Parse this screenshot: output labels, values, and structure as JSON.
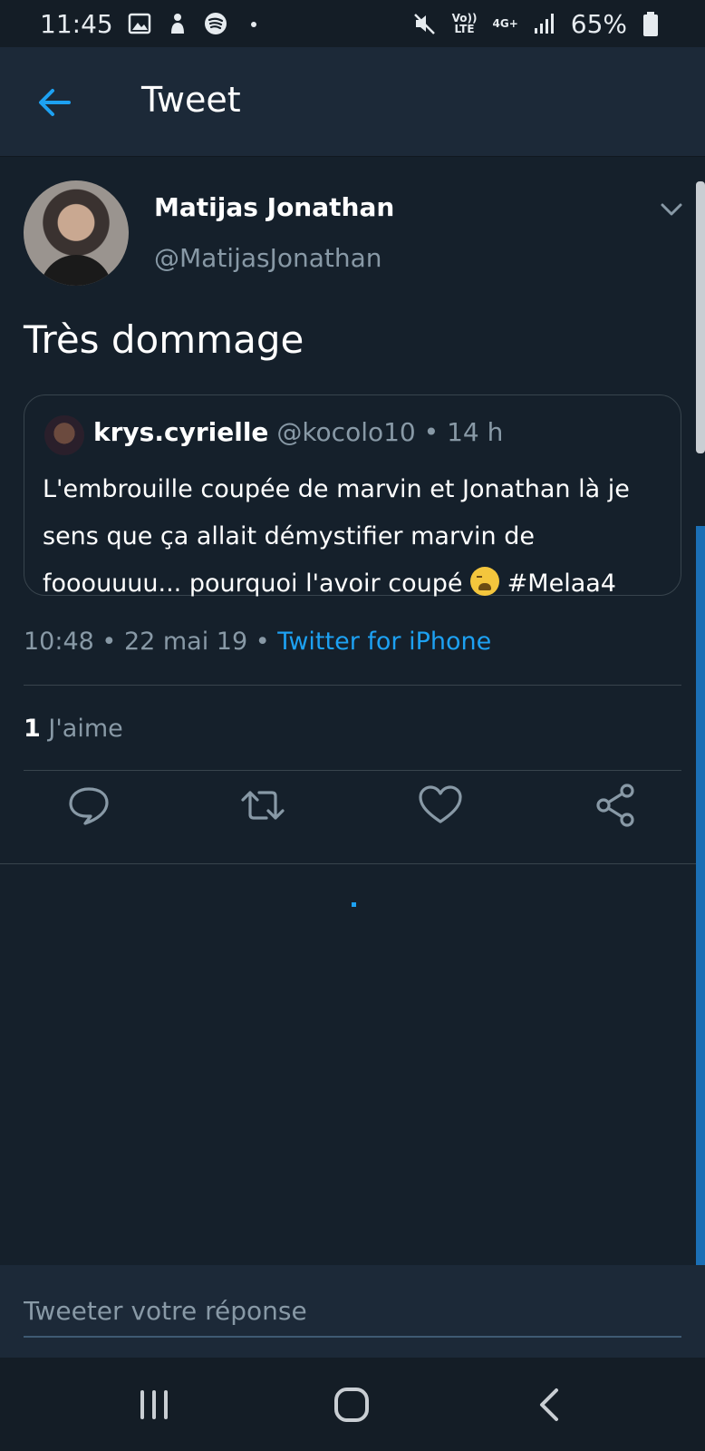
{
  "status_bar": {
    "time": "11:45",
    "volte_label": "Vo)) LTE",
    "network_label": "4G+",
    "battery": "65%"
  },
  "app_bar": {
    "title": "Tweet"
  },
  "tweet": {
    "author_name": "Matijas Jonathan",
    "author_handle": "@MatijasJonathan",
    "text": "Très dommage",
    "quoted": {
      "name": "krys.cyrielle",
      "handle": "@kocolo10",
      "separator": "•",
      "age": "14 h",
      "body": "L'embrouille coupée de marvin et Jonathan là je sens que ça allait démystifier marvin de fooouuuu... pourquoi l'avoir coupé",
      "hashtag": "#Melaa4"
    },
    "time": "10:48",
    "separator": "•",
    "date": "22 mai 19",
    "source": "Twitter for iPhone",
    "likes_count": "1",
    "likes_label": "J'aime"
  },
  "reply": {
    "placeholder": "Tweeter votre réponse"
  },
  "colors": {
    "background": "#15202b",
    "appbar": "#1c2938",
    "accent": "#1da1f2",
    "secondary_text": "#8899a6",
    "border": "#38444d"
  },
  "icons": {
    "back": "arrow-left-icon",
    "menu": "chevron-down-icon",
    "reply": "comment-icon",
    "retweet": "retweet-icon",
    "like": "heart-icon",
    "share": "share-icon"
  }
}
